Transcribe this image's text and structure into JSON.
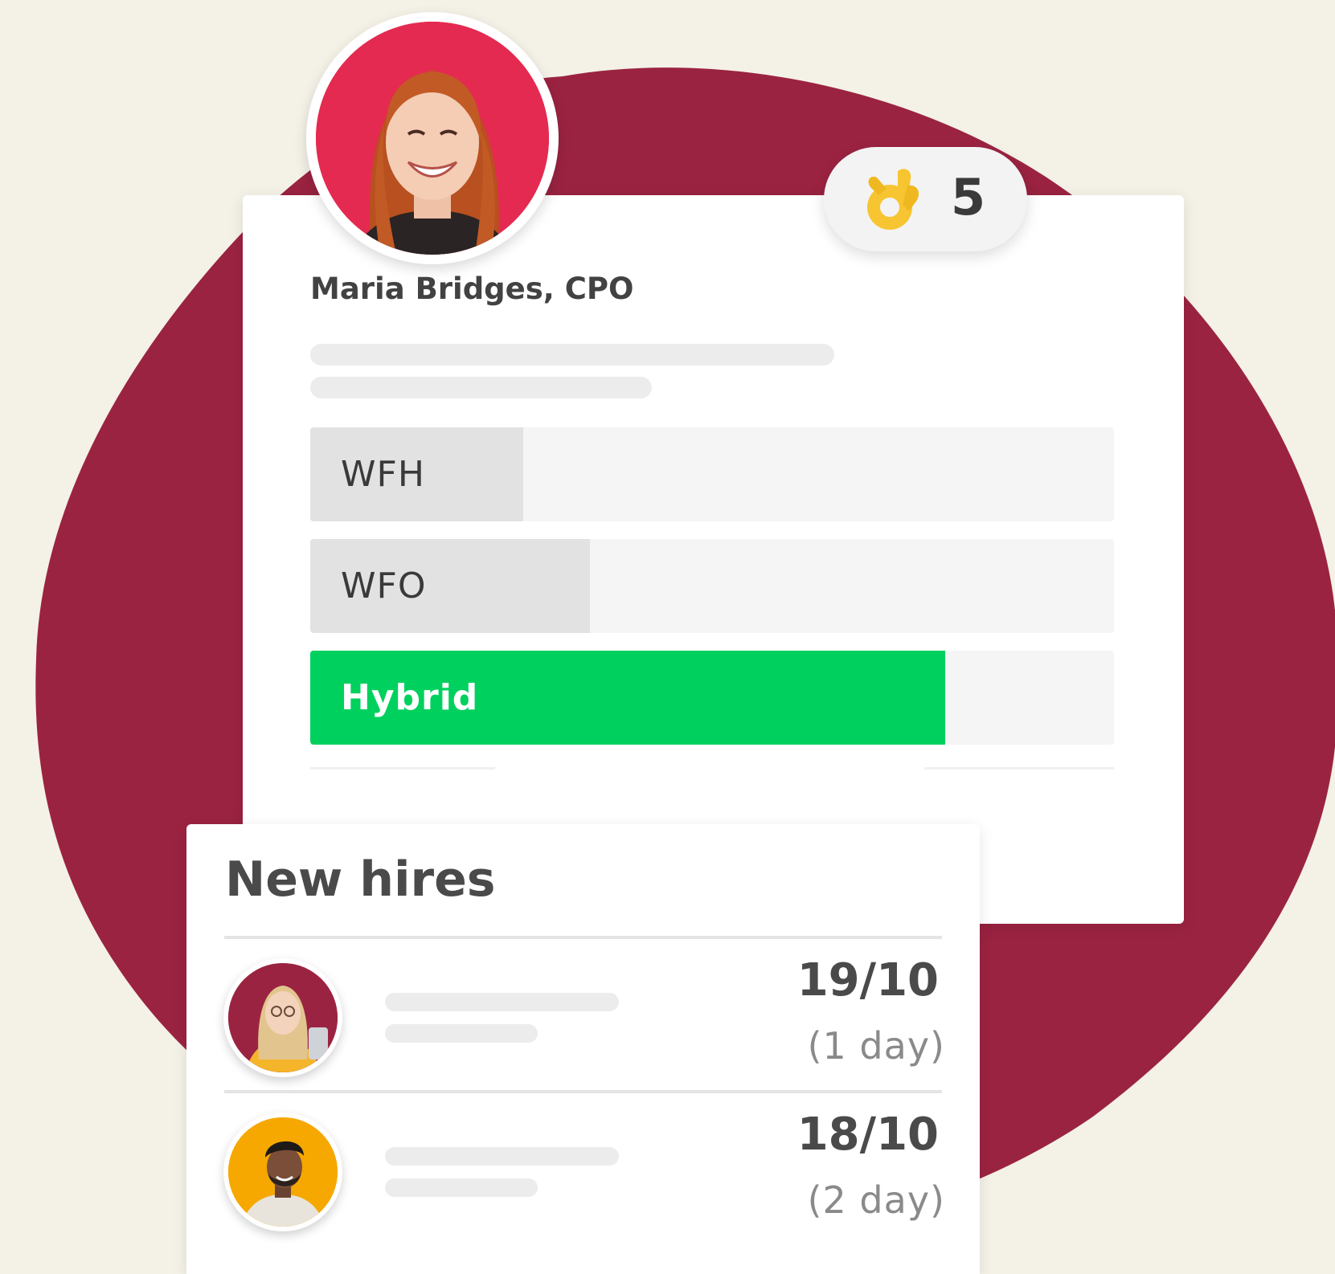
{
  "colors": {
    "background": "#f4f1e7",
    "blob": "#9b2342",
    "profile_ring": "#e42a50",
    "hybrid_green": "#00d15e",
    "option_fill": "#e2e2e2",
    "option_track": "#f5f5f5",
    "hire_1_ring": "#9b2342",
    "hire_2_ring": "#f6a800"
  },
  "profile": {
    "name": "Maria Bridges, CPO",
    "avatar_icon": "person-photo"
  },
  "reaction": {
    "emoji": "👌",
    "emoji_icon": "ok-hand-icon",
    "count": "5"
  },
  "poll": {
    "options": [
      {
        "label": "WFH",
        "share": 0.265
      },
      {
        "label": "WFO",
        "share": 0.348
      },
      {
        "label": "Hybrid",
        "share": 0.79
      }
    ]
  },
  "new_hires": {
    "title": "New hires",
    "items": [
      {
        "date": "19/10",
        "duration": "(1 day)",
        "avatar_icon": "person-photo"
      },
      {
        "date": "18/10",
        "duration": "(2 day)",
        "avatar_icon": "person-photo"
      }
    ]
  }
}
